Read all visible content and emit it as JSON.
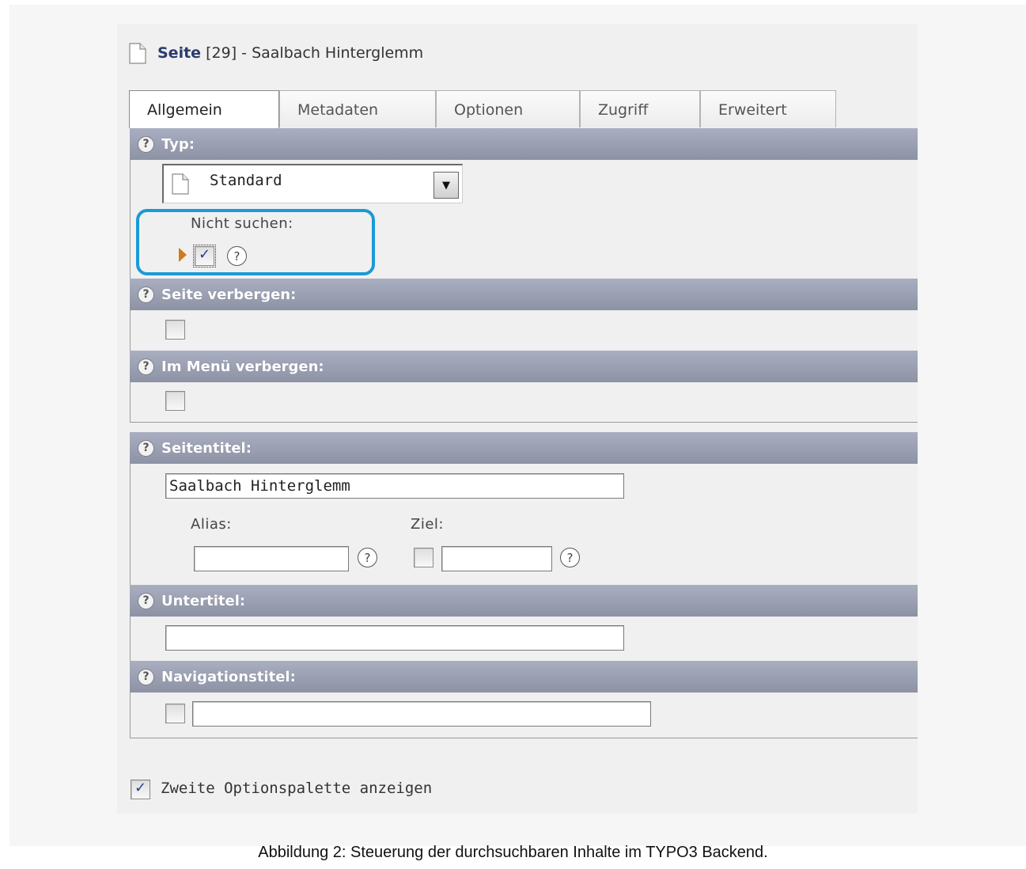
{
  "header": {
    "prefix": "Seite",
    "id": "[29]",
    "separator": " - ",
    "page_name": "Saalbach Hinterglemm"
  },
  "tabs": [
    {
      "label": "Allgemein",
      "active": true
    },
    {
      "label": "Metadaten",
      "active": false
    },
    {
      "label": "Optionen",
      "active": false
    },
    {
      "label": "Zugriff",
      "active": false
    },
    {
      "label": "Erweitert",
      "active": false
    }
  ],
  "help_glyph": "?",
  "sections": {
    "typ": {
      "label": "Typ:",
      "select_value": "Standard",
      "nicht_suchen_label": "Nicht suchen:",
      "nicht_suchen_checked": true
    },
    "seite_verbergen": {
      "label": "Seite verbergen:",
      "checked": false
    },
    "im_menu_verbergen": {
      "label": "Im Menü verbergen:",
      "checked": false
    },
    "seitentitel": {
      "label": "Seitentitel:",
      "value": "Saalbach Hinterglemm",
      "alias_label": "Alias:",
      "alias_value": "",
      "ziel_label": "Ziel:",
      "ziel_value": "",
      "ziel_checked": false
    },
    "untertitel": {
      "label": "Untertitel:",
      "value": ""
    },
    "navigationstitel": {
      "label": "Navigationstitel:",
      "value": "",
      "checked": false
    }
  },
  "second_palette": {
    "label": "Zweite Optionspalette anzeigen",
    "checked": true
  },
  "caption": "Abbildung 2: Steuerung der durchsuchbaren Inhalte im TYPO3 Backend.",
  "colors": {
    "section_bar": "#9a9fb2",
    "highlight": "#1a9ad6",
    "title_accent": "#2a3b6e",
    "pointer": "#d3791d"
  }
}
